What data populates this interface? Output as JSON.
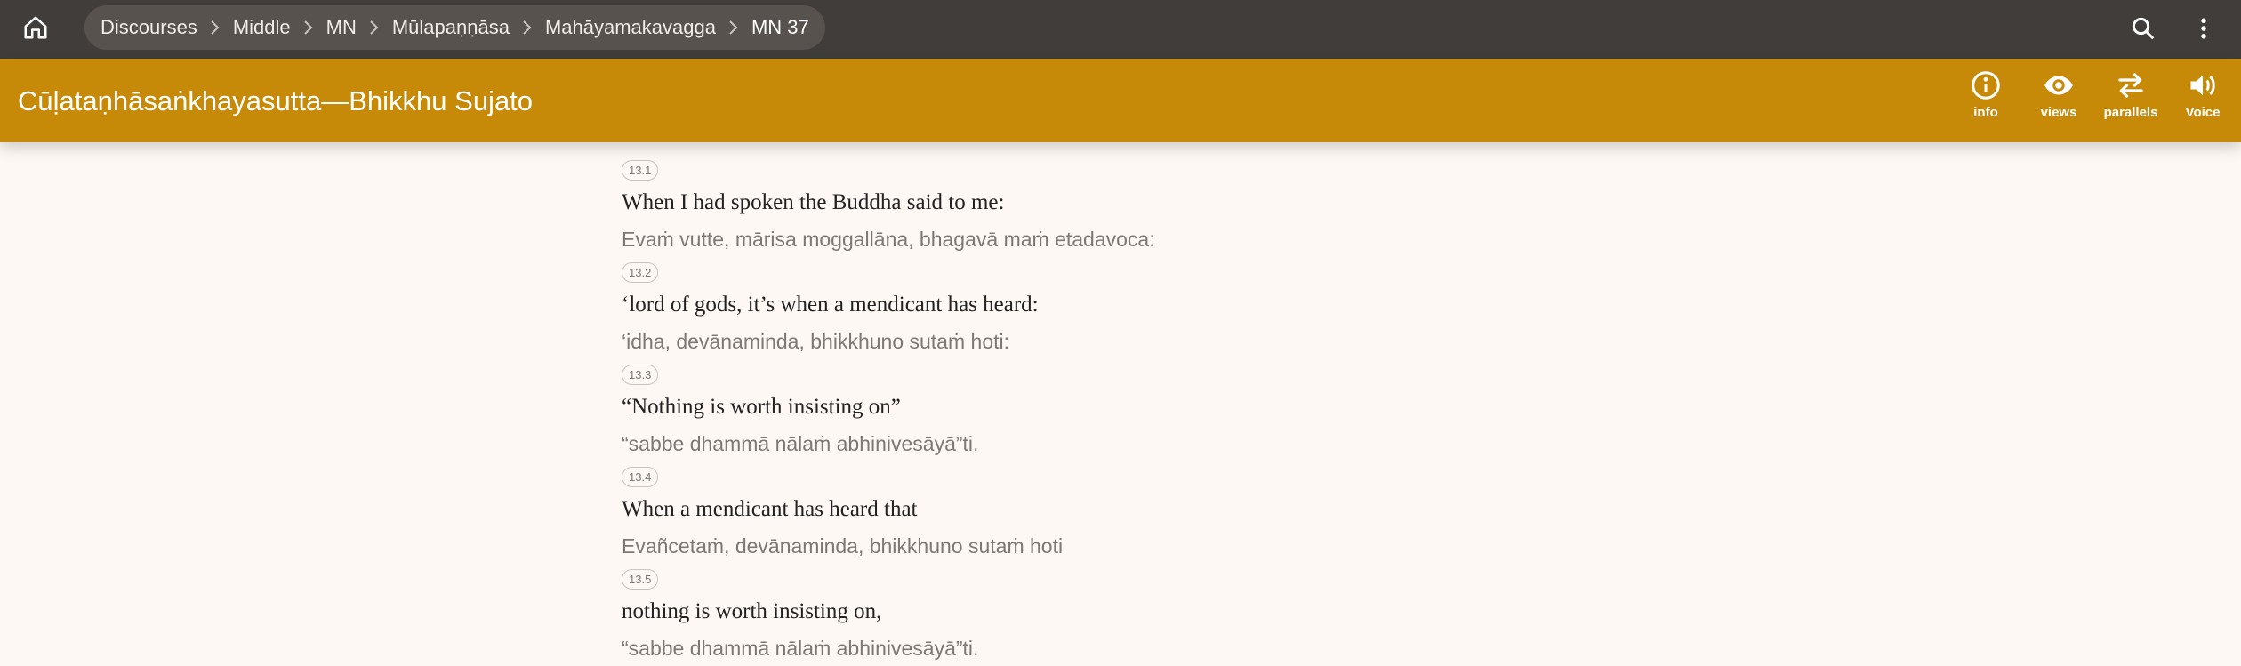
{
  "topbar": {
    "home_icon": "home-icon",
    "breadcrumb": [
      {
        "label": "Discourses"
      },
      {
        "label": "Middle"
      },
      {
        "label": "MN"
      },
      {
        "label": "Mūlapaṇṇāsa"
      },
      {
        "label": "Mahāyamakavagga"
      },
      {
        "label": "MN 37"
      }
    ],
    "actions": [
      "search-icon",
      "more-vertical-icon"
    ]
  },
  "titlebar": {
    "title": "Cūḷataṇhāsaṅkhayasutta—Bhikkhu Sujato",
    "tools": [
      {
        "label": "info",
        "icon": "info-icon"
      },
      {
        "label": "views",
        "icon": "eye-icon"
      },
      {
        "label": "parallels",
        "icon": "swap-arrows-icon"
      },
      {
        "label": "Voice",
        "icon": "speaker-icon"
      }
    ]
  },
  "colors": {
    "topbar": "#403d3b",
    "breadcrumb_bg": "#57524e",
    "titlebar": "#c68a08",
    "page_bg": "#fdf8f4"
  },
  "segments": [
    {
      "id": "13.1",
      "en": "When I had spoken the Buddha said to me:",
      "pli": "Evaṁ vutte, mārisa moggallāna, bhagavā maṁ etadavoca:"
    },
    {
      "id": "13.2",
      "en": "‘lord of gods, it’s when a mendicant has heard:",
      "pli": "‘idha, devānaminda, bhikkhuno sutaṁ hoti:"
    },
    {
      "id": "13.3",
      "en": "“Nothing is worth insisting on”",
      "pli": "“sabbe dhammā nālaṁ abhinivesāyā”ti."
    },
    {
      "id": "13.4",
      "en": "When a mendicant has heard that",
      "pli": "Evañcetaṁ, devānaminda, bhikkhuno sutaṁ hoti"
    },
    {
      "id": "13.5",
      "en": "nothing is worth insisting on,",
      "pli": "“sabbe dhammā nālaṁ abhinivesāyā”ti."
    }
  ]
}
